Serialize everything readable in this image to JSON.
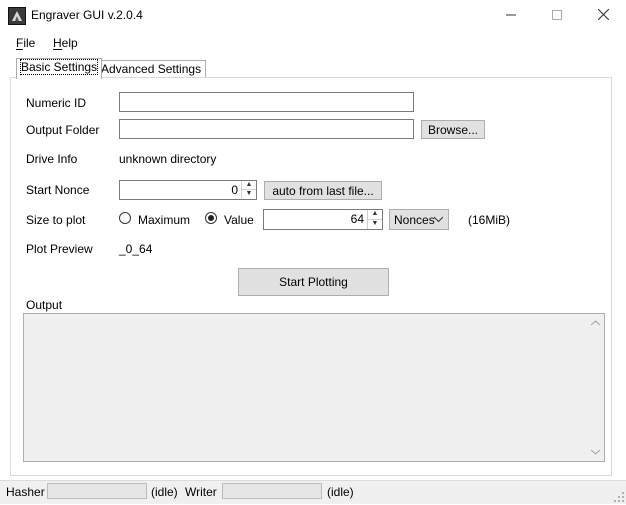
{
  "window": {
    "title": "Engraver GUI v.2.0.4",
    "minimize_icon": "minimize-icon",
    "maximize_icon": "maximize-icon",
    "close_icon": "close-icon"
  },
  "menu": {
    "file": "File",
    "help": "Help"
  },
  "tabs": [
    {
      "label": "Basic Settings",
      "active": true
    },
    {
      "label": "Advanced Settings",
      "active": false
    }
  ],
  "form": {
    "numeric_id": {
      "label": "Numeric ID",
      "value": ""
    },
    "output_folder": {
      "label": "Output Folder",
      "value": "",
      "browse_label": "Browse..."
    },
    "drive_info": {
      "label": "Drive Info",
      "value": "unknown directory"
    },
    "start_nonce": {
      "label": "Start Nonce",
      "value": "0",
      "auto_label": "auto from last file..."
    },
    "size_to_plot": {
      "label": "Size to plot",
      "maximum_label": "Maximum",
      "value_label": "Value",
      "selected": "Value",
      "amount": "64",
      "unit": "Nonces",
      "size_note": "(16MiB)"
    },
    "plot_preview": {
      "label": "Plot Preview",
      "value": "_0_64"
    },
    "start_button": "Start Plotting",
    "output_label": "Output"
  },
  "status": {
    "hasher_label": "Hasher",
    "hasher_state": "(idle)",
    "writer_label": "Writer",
    "writer_state": "(idle)",
    "hasher_progress": 0,
    "writer_progress": 0
  }
}
